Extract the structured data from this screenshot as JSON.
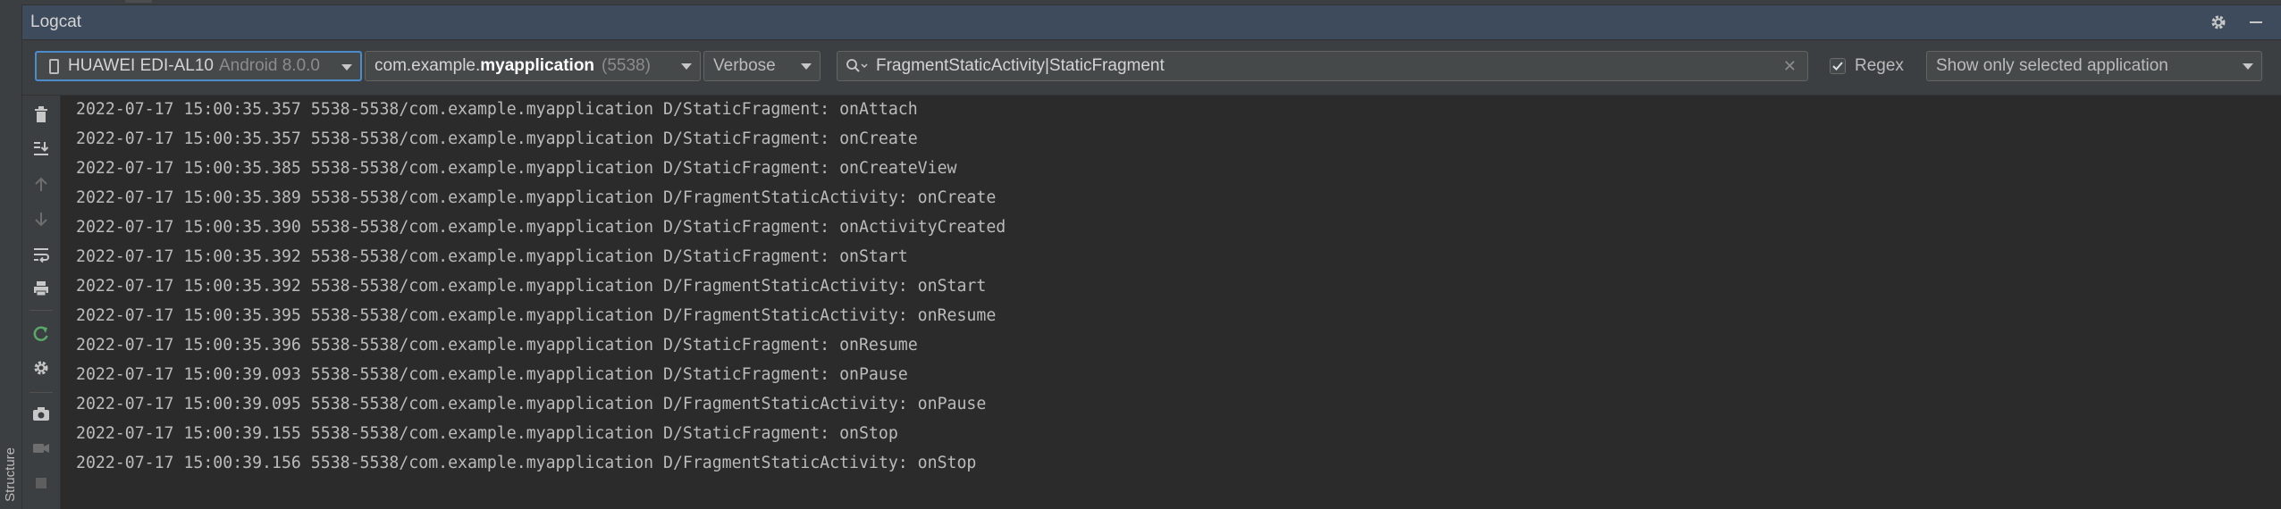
{
  "window": {
    "title": "Logcat"
  },
  "toolbar": {
    "device_name": "HUAWEI EDI-AL10",
    "device_os": "Android 8.0.0",
    "process_prefix": "com.example.",
    "process_bold": "myapplication",
    "process_pid": "(5538)",
    "log_level": "Verbose",
    "search_value": "FragmentStaticActivity|StaticFragment",
    "regex_label": "Regex",
    "regex_checked": true,
    "filter_option": "Show only selected application"
  },
  "structure_label": "Structure",
  "icons": {
    "settings": "gear-icon",
    "minimize": "minimize-icon",
    "device": "phone-icon",
    "search": "search-icon",
    "clear": "clear-icon",
    "clear_logcat": "trash-icon",
    "scroll_to_end": "scroll-to-end-icon",
    "up": "arrow-up-icon",
    "down": "arrow-down-icon",
    "soft_wrap": "soft-wrap-icon",
    "print": "print-icon",
    "restart": "restart-icon",
    "side_settings": "gear-icon",
    "screenshot": "camera-icon",
    "screen_record": "video-camera-icon",
    "stop": "stop-icon"
  },
  "log_lines": [
    "2022-07-17 15:00:35.357 5538-5538/com.example.myapplication D/StaticFragment: onAttach",
    "2022-07-17 15:00:35.357 5538-5538/com.example.myapplication D/StaticFragment: onCreate",
    "2022-07-17 15:00:35.385 5538-5538/com.example.myapplication D/StaticFragment: onCreateView",
    "2022-07-17 15:00:35.389 5538-5538/com.example.myapplication D/FragmentStaticActivity: onCreate",
    "2022-07-17 15:00:35.390 5538-5538/com.example.myapplication D/StaticFragment: onActivityCreated",
    "2022-07-17 15:00:35.392 5538-5538/com.example.myapplication D/StaticFragment: onStart",
    "2022-07-17 15:00:35.392 5538-5538/com.example.myapplication D/FragmentStaticActivity: onStart",
    "2022-07-17 15:00:35.395 5538-5538/com.example.myapplication D/FragmentStaticActivity: onResume",
    "2022-07-17 15:00:35.396 5538-5538/com.example.myapplication D/StaticFragment: onResume",
    "2022-07-17 15:00:39.093 5538-5538/com.example.myapplication D/StaticFragment: onPause",
    "2022-07-17 15:00:39.095 5538-5538/com.example.myapplication D/FragmentStaticActivity: onPause",
    "2022-07-17 15:00:39.155 5538-5538/com.example.myapplication D/StaticFragment: onStop",
    "2022-07-17 15:00:39.156 5538-5538/com.example.myapplication D/FragmentStaticActivity: onStop"
  ],
  "colors": {
    "title_bar": "#3d4b5c",
    "panel": "#3c3f41",
    "editor_bg": "#2b2b2b",
    "text": "#bbbbbb",
    "focus": "#4c8ccc",
    "restart_green": "#59a869"
  }
}
